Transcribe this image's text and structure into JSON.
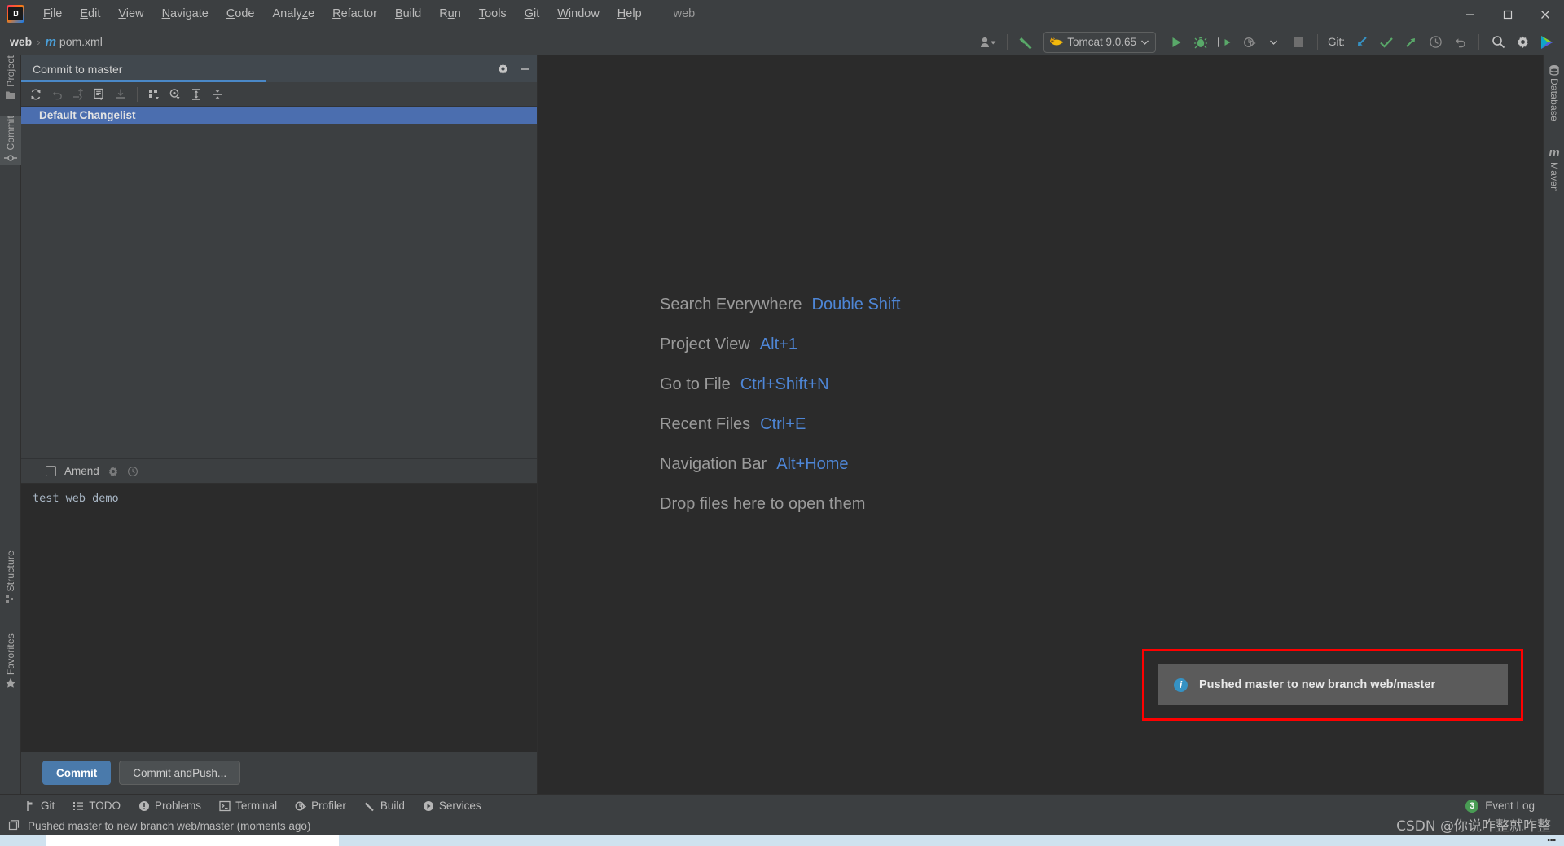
{
  "window": {
    "title": "web",
    "controls": [
      "minimize",
      "maximize",
      "close"
    ]
  },
  "menu": {
    "items": [
      {
        "label": "File",
        "mnemonic": "F"
      },
      {
        "label": "Edit",
        "mnemonic": "E"
      },
      {
        "label": "View",
        "mnemonic": "V"
      },
      {
        "label": "Navigate",
        "mnemonic": "N"
      },
      {
        "label": "Code",
        "mnemonic": "C"
      },
      {
        "label": "Analyze",
        "mnemonic": "z"
      },
      {
        "label": "Refactor",
        "mnemonic": "R"
      },
      {
        "label": "Build",
        "mnemonic": "B"
      },
      {
        "label": "Run",
        "mnemonic": "u"
      },
      {
        "label": "Tools",
        "mnemonic": "T"
      },
      {
        "label": "Git",
        "mnemonic": "G"
      },
      {
        "label": "Window",
        "mnemonic": "W"
      },
      {
        "label": "Help",
        "mnemonic": "H"
      }
    ]
  },
  "navbar": {
    "breadcrumb": {
      "project": "web",
      "separator": "›",
      "file": "pom.xml",
      "file_icon": "maven-m-icon"
    },
    "run_configuration": {
      "label": "Tomcat 9.0.65",
      "icon": "tomcat-cat-icon",
      "dropdown_icon": "chevron-down-icon"
    },
    "git_label": "Git:",
    "actions": [
      "account-icon",
      "hammer-build-icon",
      "run-icon",
      "debug-icon",
      "run-with-coverage-icon",
      "profile-icon",
      "stop-icon",
      "git-update-icon",
      "git-commit-icon",
      "git-push-icon",
      "history-icon",
      "rollback-icon",
      "search-icon",
      "settings-icon",
      "ide-assistant-icon"
    ]
  },
  "left_stripe": {
    "tabs": [
      {
        "label": "Project",
        "icon": "folder-icon",
        "active": false
      },
      {
        "label": "Commit",
        "icon": "commit-icon",
        "active": true
      },
      {
        "label": "Structure",
        "icon": "structure-icon",
        "active": false
      },
      {
        "label": "Favorites",
        "icon": "star-icon",
        "active": false
      }
    ]
  },
  "right_stripe": {
    "tabs": [
      {
        "label": "Database",
        "icon": "database-icon"
      },
      {
        "label": "Maven",
        "icon": "maven-m-icon"
      }
    ]
  },
  "commit_window": {
    "tab_title": "Commit to master",
    "header_actions": [
      "settings-gear-icon",
      "minimize-icon"
    ],
    "toolbar_icons": [
      "refresh-icon",
      "rollback-icon",
      "move-to-another-changelist-icon",
      "show-diff-icon",
      "shelve-icon",
      "group-by-icon",
      "preview-diff-icon",
      "expand-all-icon",
      "collapse-all-icon"
    ],
    "changelist": {
      "name": "Default Changelist",
      "selected": true
    },
    "amend": {
      "label": "Amend",
      "mnemonic": "m",
      "checked": false,
      "icons": [
        "commit-options-gear-icon",
        "commit-history-icon"
      ]
    },
    "commit_message": "test web demo",
    "buttons": [
      {
        "label": "Commit",
        "mnemonic": "i",
        "primary": true
      },
      {
        "label": "Commit and Push...",
        "mnemonic": "P",
        "primary": false
      }
    ]
  },
  "editor": {
    "tips": [
      {
        "name": "Search Everywhere",
        "keys": "Double Shift"
      },
      {
        "name": "Project View",
        "keys": "Alt+1"
      },
      {
        "name": "Go to File",
        "keys": "Ctrl+Shift+N"
      },
      {
        "name": "Recent Files",
        "keys": "Ctrl+E"
      },
      {
        "name": "Navigation Bar",
        "keys": "Alt+Home"
      },
      {
        "name": "Drop files here to open them",
        "keys": ""
      }
    ]
  },
  "notification": {
    "message": "Pushed master to new branch web/master",
    "icon": "info-icon",
    "highlight_color": "#ff0000"
  },
  "bottom_bar": {
    "items": [
      {
        "label": "Git",
        "icon": "git-branch-icon"
      },
      {
        "label": "TODO",
        "icon": "todo-list-icon"
      },
      {
        "label": "Problems",
        "icon": "problems-icon"
      },
      {
        "label": "Terminal",
        "icon": "terminal-icon"
      },
      {
        "label": "Profiler",
        "icon": "profiler-icon"
      },
      {
        "label": "Build",
        "icon": "hammer-build-icon"
      },
      {
        "label": "Services",
        "icon": "services-icon"
      }
    ],
    "event_log": {
      "label": "Event Log",
      "badge": "3"
    }
  },
  "status_bar": {
    "icon": "status-window-icon",
    "message": "Pushed master to new branch web/master (moments ago)"
  },
  "watermark": "CSDN @你说咋整就咋整",
  "colors": {
    "accent_blue": "#4b6eaf",
    "link_blue": "#4e86d6",
    "panel_bg": "#3c3f41",
    "editor_bg": "#2b2b2b",
    "notif_highlight": "#ff0000",
    "badge_green": "#499c54"
  }
}
